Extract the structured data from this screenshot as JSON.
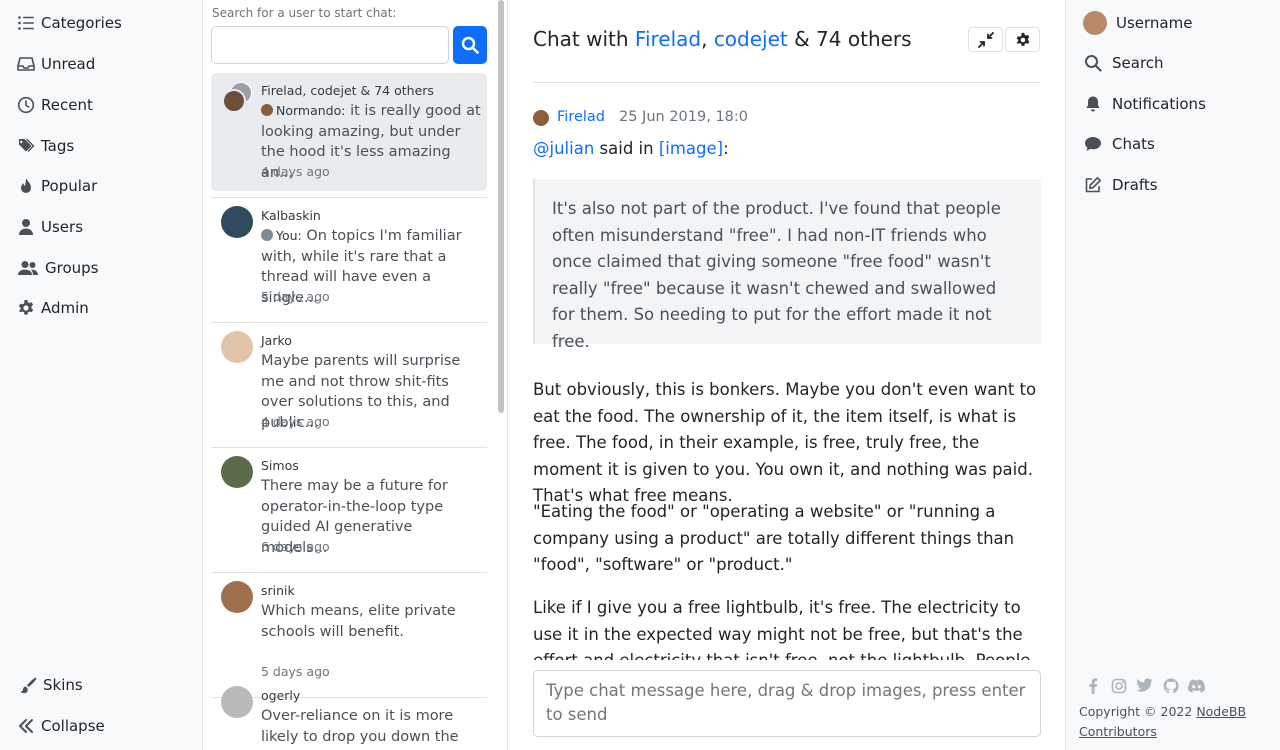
{
  "left_nav": {
    "items": [
      {
        "label": "Categories",
        "icon": "list-icon"
      },
      {
        "label": "Unread",
        "icon": "inbox-icon"
      },
      {
        "label": "Recent",
        "icon": "clock-icon"
      },
      {
        "label": "Tags",
        "icon": "tags-icon"
      },
      {
        "label": "Popular",
        "icon": "fire-icon"
      },
      {
        "label": "Users",
        "icon": "user-icon"
      },
      {
        "label": "Groups",
        "icon": "users-icon"
      },
      {
        "label": "Admin",
        "icon": "gear-icon"
      }
    ],
    "skins": "Skins",
    "collapse": "Collapse"
  },
  "chat_list": {
    "search_label": "Search for a user to start chat:",
    "search_value": "",
    "items": [
      {
        "names": "Firelad, codejet & 74 others",
        "sender": "Normando:",
        "text": "it is really good at looking amazing, but under the hood it's less amazing an...",
        "ago": "4 days ago",
        "active": true
      },
      {
        "names": "Kalbaskin",
        "sender": "You:",
        "text": "On topics I'm familiar with, while it's rare that a thread will have even a single...",
        "ago": "5 days ago"
      },
      {
        "names": "Jarko",
        "sender": "",
        "text": "Maybe parents will surprise me and not throw shit-fits over solutions to this, and public...",
        "ago": "4 days ago"
      },
      {
        "names": "Simos",
        "sender": "",
        "text": "There may be a future for operator-in-the-loop type guided AI generative models...",
        "ago": "6 days ago"
      },
      {
        "names": "srinik",
        "sender": "",
        "text": "Which means, elite private schools will benefit.",
        "ago": "5 days ago"
      },
      {
        "names": "ogerly",
        "sender": "",
        "text": "Over-reliance on it is more likely to drop you down the 'Xx",
        "ago": ""
      }
    ]
  },
  "main": {
    "title_prefix": "Chat with ",
    "title_user1": "Firelad",
    "title_sep": ", ",
    "title_user2": "codejet",
    "title_suffix": " & 74 others",
    "message": {
      "author": "Firelad",
      "time": "25 Jun 2019, 18:0",
      "mention": "@julian",
      "said_in": " said in ",
      "link": "[image]",
      "colon": ":",
      "quote": "It's also not part of the product. I've found that people often misunderstand \"free\". I had non-IT friends who once claimed that giving someone \"free food\" wasn't really \"free\" because it wasn't chewed and swallowed for them. So needing to put for the effort made it not free.",
      "paragraphs": [
        "But obviously, this is bonkers. Maybe you don't even want to eat the food. The ownership of it, the item itself, is what is free. The food, in their example, is free, truly free, the moment it is given to you. You own it, and nothing was paid. That's what free means.",
        "\"Eating the food\" or \"operating a website\" or \"running a company using a product\" are totally different things than \"food\", \"software\" or \"product.\"",
        "Like if I give you a free lightbulb, it's free. The electricity to use it in the expected way might not be free, but that's the effort and electricity that isn't free, not the lightbulb. People often confuse"
      ]
    },
    "composer_placeholder": "Type chat message here, drag & drop images, press enter to send"
  },
  "right_nav": {
    "items": [
      {
        "label": "Username",
        "icon": "avatar"
      },
      {
        "label": "Search",
        "icon": "search-icon"
      },
      {
        "label": "Notifications",
        "icon": "bell-icon"
      },
      {
        "label": "Chats",
        "icon": "comment-icon"
      },
      {
        "label": "Drafts",
        "icon": "edit-icon"
      }
    ],
    "copyright_text": "Copyright © 2022 ",
    "copyright_link": "NodeBB Contributors"
  },
  "colors": {
    "accent": "#0d6efd",
    "sidebar_bg": "#f8f9fa",
    "active_chat_bg": "#e9ecef",
    "quote_bg": "#f3f4f5"
  }
}
